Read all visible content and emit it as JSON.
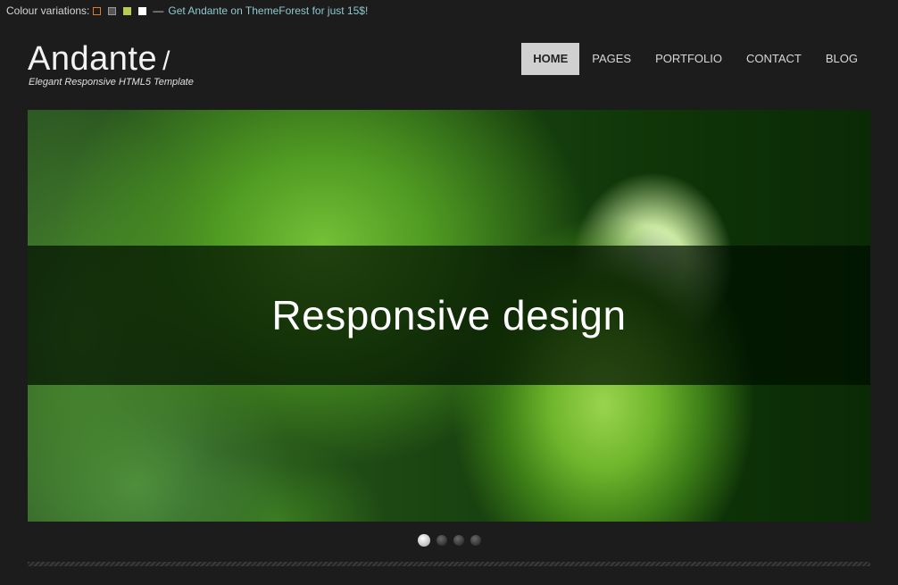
{
  "topbar": {
    "label": "Colour variations:",
    "swatches": [
      {
        "name": "orange",
        "fill": "#1b1c1b",
        "border": "#e07a2e"
      },
      {
        "name": "grey",
        "fill": "#555555",
        "border": "#999999"
      },
      {
        "name": "lime",
        "fill": "#b6cc52",
        "border": "#b6cc52"
      },
      {
        "name": "white",
        "fill": "#ffffff",
        "border": "#ffffff"
      }
    ],
    "dash": "—",
    "promo": "Get Andante on ThemeForest for just 15$!"
  },
  "header": {
    "logo": "Andante",
    "logo_slash": "/",
    "tagline": "Elegant Responsive HTML5 Template"
  },
  "nav": {
    "items": [
      {
        "label": "HOME",
        "active": true
      },
      {
        "label": "PAGES",
        "active": false
      },
      {
        "label": "PORTFOLIO",
        "active": false
      },
      {
        "label": "CONTACT",
        "active": false
      },
      {
        "label": "BLOG",
        "active": false
      }
    ]
  },
  "slider": {
    "caption": "Responsive design",
    "dots": {
      "count": 4,
      "active_index": 0
    }
  }
}
